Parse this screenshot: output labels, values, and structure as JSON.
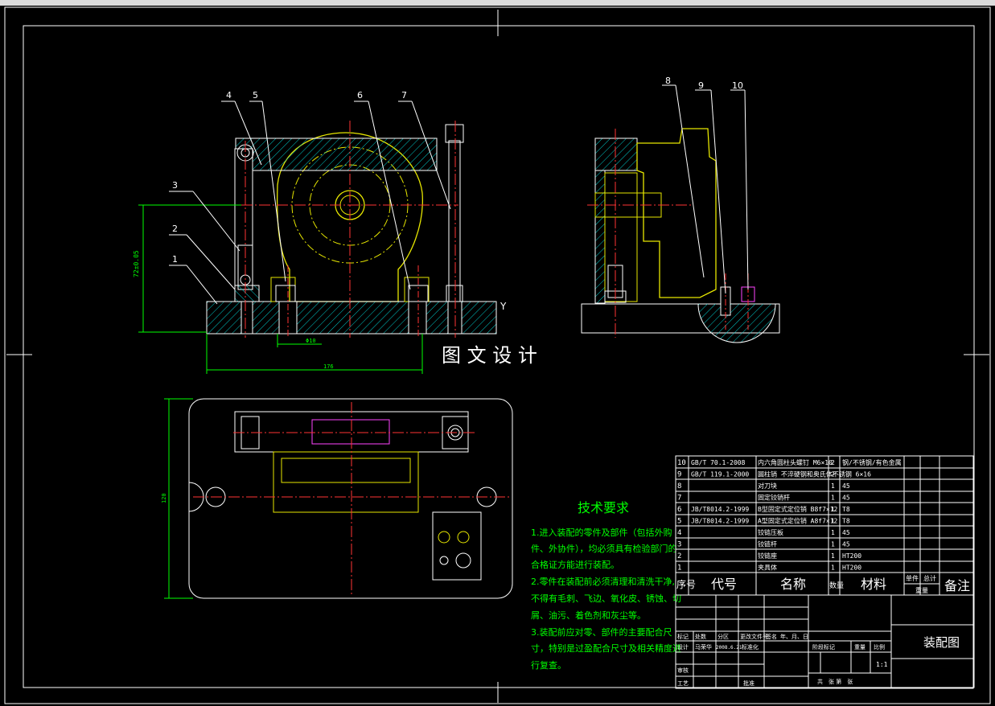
{
  "watermark": "图 文 设 计",
  "axis_letter": "Y",
  "balloons": [
    "1",
    "2",
    "3",
    "4",
    "5",
    "6",
    "7",
    "8",
    "9",
    "10"
  ],
  "dimensions": {
    "height_ref": "72±0.05",
    "bore": "Φ10",
    "width": "176",
    "plan_height": "120"
  },
  "tech_requirements": {
    "title": "技术要求",
    "lines": [
      "1.进入装配的零件及部件（包括外购",
      "件、外协件），均必须具有检验部门的",
      "合格证方能进行装配。",
      "2.零件在装配前必须清理和清洗干净,",
      "不得有毛刺、飞边、氧化皮、锈蚀、切",
      "屑、油污、着色剂和灰尘等。",
      "3.装配前应对零、部件的主要配合尺",
      "寸，特别是过盈配合尺寸及相关精度进",
      "行复查。"
    ]
  },
  "bom": {
    "rows": [
      {
        "no": "10",
        "code": "GB/T 70.1-2008",
        "name": "内六角圆柱头螺钉 M6×10",
        "qty": "2",
        "material": "钢/不锈钢/有色金属"
      },
      {
        "no": "9",
        "code": "GB/T 119.1-2000",
        "name": "圆柱销 不淬硬钢和奥氏体不锈钢 6×16",
        "qty": "2",
        "material": ""
      },
      {
        "no": "8",
        "code": "",
        "name": "对刀块",
        "qty": "1",
        "material": "45"
      },
      {
        "no": "7",
        "code": "",
        "name": "固定铰销杆",
        "qty": "1",
        "material": "45"
      },
      {
        "no": "6",
        "code": "JB/T8014.2-1999",
        "name": "B型固定式定位销 B8f7×12",
        "qty": "1",
        "material": "T8"
      },
      {
        "no": "5",
        "code": "JB/T8014.2-1999",
        "name": "A型固定式定位销 A8f7×12",
        "qty": "1",
        "material": "T8"
      },
      {
        "no": "4",
        "code": "",
        "name": "铰链压板",
        "qty": "1",
        "material": "45"
      },
      {
        "no": "3",
        "code": "",
        "name": "铰链杆",
        "qty": "1",
        "material": "45"
      },
      {
        "no": "2",
        "code": "",
        "name": "铰链座",
        "qty": "1",
        "material": "HT200"
      },
      {
        "no": "1",
        "code": "",
        "name": "夹具体",
        "qty": "1",
        "material": "HT200"
      }
    ],
    "header": {
      "no": "序号",
      "code": "代号",
      "name": "名称",
      "qty": "数量",
      "material": "材料",
      "unit_weight": "单件",
      "total_weight": "总计",
      "weight": "重量",
      "remark": "备注"
    }
  },
  "title_block": {
    "title": "装配图",
    "row_labels": [
      "标记",
      "处数",
      "分区",
      "更改文件号",
      "签名",
      "年、月、日"
    ],
    "design_label": "设计",
    "designer": "马荣华",
    "date": "2008.6.21",
    "standard_label": "标准化",
    "review_label": "审核",
    "process_label": "工艺",
    "approve_label": "批准",
    "stage_label": "阶段标记",
    "weight_label": "重量",
    "scale_label": "比例",
    "scale": "1:1",
    "sheets": "共　张 第　张"
  }
}
